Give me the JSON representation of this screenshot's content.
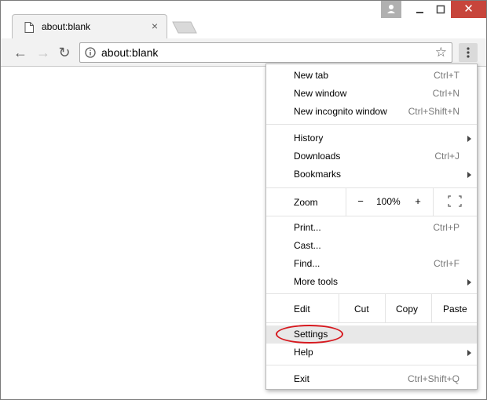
{
  "tab": {
    "title": "about:blank",
    "close_glyph": "×",
    "icon": "page-icon"
  },
  "window_controls": {
    "close_glyph": "✕"
  },
  "toolbar": {
    "back_glyph": "←",
    "forward_glyph": "→",
    "reload_glyph": "↻",
    "url": "about:blank",
    "star_glyph": "☆"
  },
  "menu": {
    "new_tab": {
      "label": "New tab",
      "shortcut": "Ctrl+T"
    },
    "new_window": {
      "label": "New window",
      "shortcut": "Ctrl+N"
    },
    "new_incognito": {
      "label": "New incognito window",
      "shortcut": "Ctrl+Shift+N"
    },
    "history": {
      "label": "History"
    },
    "downloads": {
      "label": "Downloads",
      "shortcut": "Ctrl+J"
    },
    "bookmarks": {
      "label": "Bookmarks"
    },
    "zoom": {
      "label": "Zoom",
      "minus": "−",
      "value": "100%",
      "plus": "+"
    },
    "print": {
      "label": "Print...",
      "shortcut": "Ctrl+P"
    },
    "cast": {
      "label": "Cast..."
    },
    "find": {
      "label": "Find...",
      "shortcut": "Ctrl+F"
    },
    "more_tools": {
      "label": "More tools"
    },
    "edit": {
      "label": "Edit",
      "cut": "Cut",
      "copy": "Copy",
      "paste": "Paste"
    },
    "settings": {
      "label": "Settings"
    },
    "help": {
      "label": "Help"
    },
    "exit": {
      "label": "Exit",
      "shortcut": "Ctrl+Shift+Q"
    }
  },
  "colors": {
    "annotation": "#d6191f",
    "close_button": "#c7453b"
  }
}
